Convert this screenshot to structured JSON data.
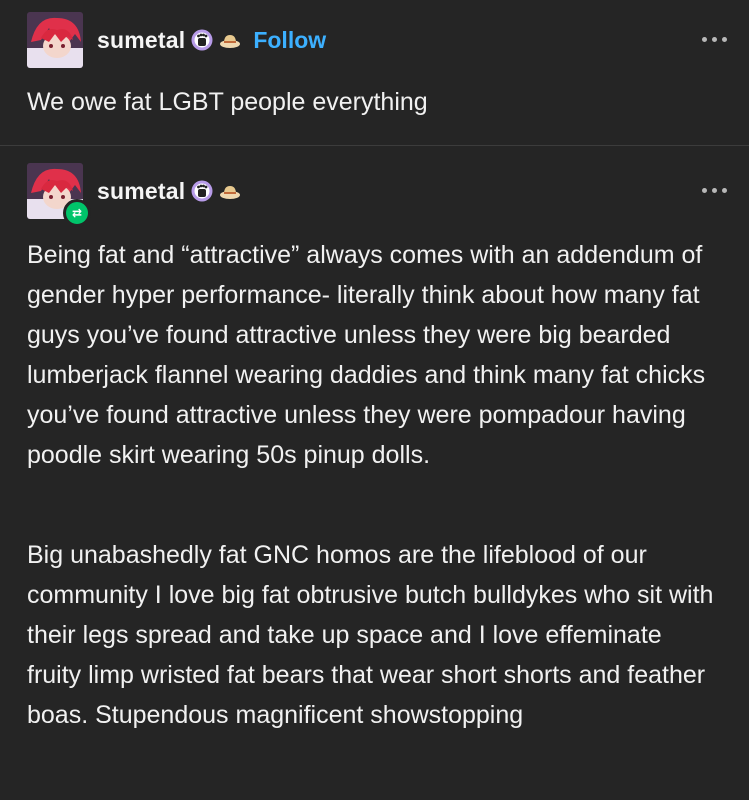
{
  "original_post": {
    "username": "sumetal",
    "follow_label": "Follow",
    "text": "We owe fat LGBT people everything"
  },
  "reblog": {
    "username": "sumetal",
    "paragraphs": [
      "Being fat and “attractive” always comes with an addendum of gender hyper performance- literally think about how many fat guys you’ve found attractive unless they were big bearded lumberjack flannel wearing daddies and think many fat chicks you’ve found attractive unless they were pompadour having poodle skirt wearing 50s pinup dolls.",
      "Big unabashedly fat GNC homos are the lifeblood of our community I love big fat obtrusive butch bulldykes who sit with their legs spread and take up space and I love effeminate fruity limp wristed fat bears that wear short shorts and feather boas. Stupendous magnificent showstopping"
    ]
  },
  "colors": {
    "background": "#252525",
    "follow": "#3cb0ff",
    "reblog_badge": "#00c46a"
  },
  "icons": [
    "paw-badge-icon",
    "hat-badge-icon",
    "more-options-icon",
    "reblog-icon"
  ]
}
